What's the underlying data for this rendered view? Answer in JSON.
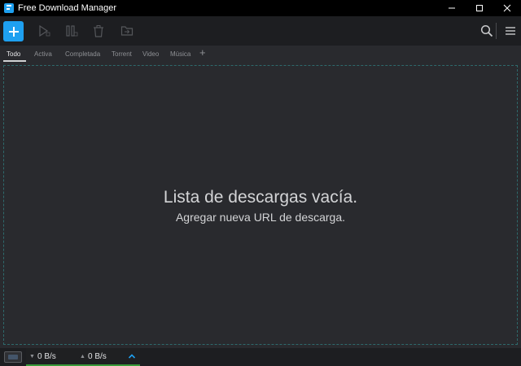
{
  "window": {
    "title": "Free Download Manager",
    "controls": {
      "minimize_icon": "minimize-icon",
      "maximize_icon": "maximize-icon",
      "close_icon": "close-icon"
    }
  },
  "toolbar": {
    "add_icon": "plus-icon",
    "start_icon": "play-icon",
    "pause_icon": "pause-icon",
    "delete_icon": "trash-icon",
    "move_icon": "folder-move-icon",
    "search_icon": "search-icon",
    "menu_icon": "hamburger-menu-icon",
    "accent_color": "#1ea0f0"
  },
  "tabs": [
    {
      "label": "Todo",
      "active": true
    },
    {
      "label": "Activa",
      "active": false
    },
    {
      "label": "Completada",
      "active": false
    },
    {
      "label": "Torrent",
      "active": false
    },
    {
      "label": "Video",
      "active": false
    },
    {
      "label": "Música",
      "active": false
    }
  ],
  "tab_add_label": "+",
  "empty_state": {
    "title": "Lista de descargas vacía.",
    "subtitle": "Agregar nueva URL de descarga."
  },
  "statusbar": {
    "download_speed": "0 B/s",
    "upload_speed": "0 B/s",
    "down_arrow": "▼",
    "up_arrow": "▲",
    "status_color": "#3a9a3a"
  }
}
